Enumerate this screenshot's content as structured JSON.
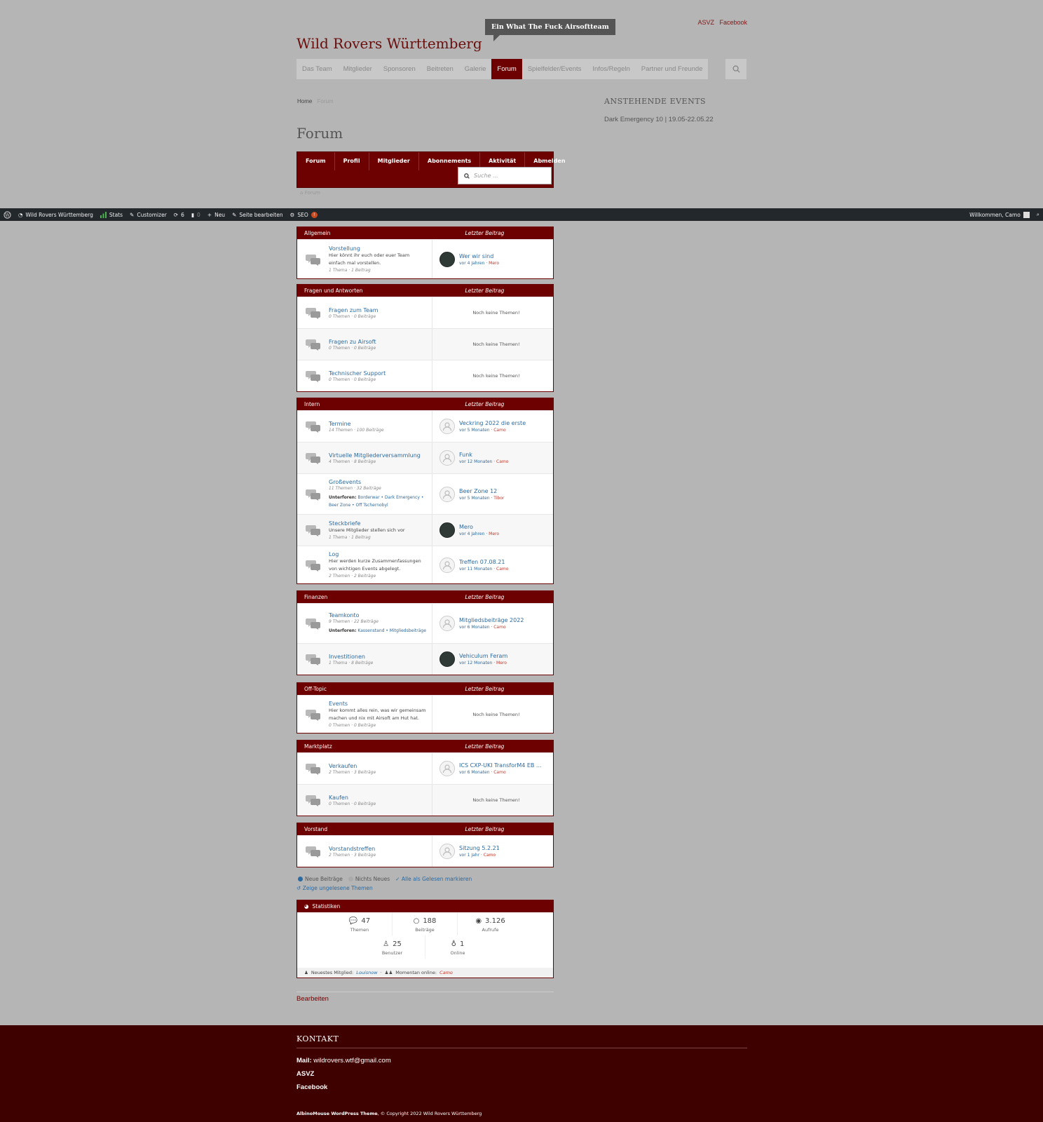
{
  "header": {
    "top_links": [
      "ASVZ",
      "Facebook"
    ],
    "tooltip": "Ein What The Fuck Airsoftteam",
    "site_title": "Wild Rovers Württemberg",
    "nav": [
      "Das Team",
      "Mitglieder",
      "Sponsoren",
      "Beitreten",
      "Galerie",
      "Forum",
      "Spielfelder/Events",
      "Infos/Regeln",
      "Partner und Freunde"
    ],
    "nav_active": "Forum"
  },
  "breadcrumb": {
    "home": "Home",
    "current": "Forum"
  },
  "page_title": "Forum",
  "sidebar": {
    "title": "ANSTEHENDE EVENTS",
    "event": "Dark Emergency 10 | 19.05-22.05.22"
  },
  "forum_nav": {
    "tabs": [
      "Forum",
      "Profil",
      "Mitglieder",
      "Abonnements",
      "Aktivität",
      "Abmelden"
    ],
    "search_placeholder": "Suche ...",
    "crumb": "Forum"
  },
  "adminbar": {
    "site": "Wild Rovers Württemberg",
    "stats": "Stats",
    "customizer": "Customizer",
    "updates": "6",
    "comments": "0",
    "new": "Neu",
    "edit_page": "Seite bearbeiten",
    "seo": "SEO",
    "seo_badge": "!",
    "welcome": "Willkommen, Camo"
  },
  "last_post_label": "Letzter Beitrag",
  "no_topics": "Noch keine Themen!",
  "subforums_label": "Unterforen:",
  "categories": [
    {
      "name": "Allgemein",
      "forums": [
        {
          "title": "Vorstellung",
          "desc": "Hier könnt ihr euch oder euer Team einfach mal vorstellen.",
          "meta": "1 Thema · 1 Beitrag",
          "last": {
            "title": "Wer wir sind",
            "time": "vor 4 Jahren",
            "by": "Mero"
          }
        }
      ]
    },
    {
      "name": "Fragen und Antworten",
      "forums": [
        {
          "title": "Fragen zum Team",
          "meta": "0 Themen · 0 Beiträge"
        },
        {
          "title": "Fragen zu Airsoft",
          "meta": "0 Themen · 0 Beiträge"
        },
        {
          "title": "Technischer Support",
          "meta": "0 Themen · 0 Beiträge"
        }
      ]
    },
    {
      "name": "Intern",
      "forums": [
        {
          "title": "Termine",
          "meta": "14 Themen · 100 Beiträge",
          "last": {
            "title": "Veckring 2022 die erste",
            "time": "vor 5 Monaten",
            "by": "Camo"
          }
        },
        {
          "title": "Virtuelle Mitgliederversammlung",
          "meta": "4 Themen · 8 Beiträge",
          "last": {
            "title": "Funk",
            "time": "vor 12 Monaten",
            "by": "Camo"
          }
        },
        {
          "title": "Großevents",
          "meta": "11 Themen · 32 Beiträge",
          "subforums": "Borderwar • Dark Emergency • Beer Zone • Off Tschernobyl",
          "last": {
            "title": "Beer Zone 12",
            "time": "vor 5 Monaten",
            "by": "Tibor"
          }
        },
        {
          "title": "Steckbriefe",
          "desc": "Unsere Mitglieder stellen sich vor",
          "meta": "1 Thema · 1 Beitrag",
          "last": {
            "title": "Mero",
            "time": "vor 4 Jahren",
            "by": "Mero"
          }
        },
        {
          "title": "Log",
          "desc": "Hier werden kurze Zusammenfassungen von wichtigen Events abgelegt.",
          "meta": "2 Themen · 2 Beiträge",
          "last": {
            "title": "Treffen 07.08.21",
            "time": "vor 11 Monaten",
            "by": "Camo"
          }
        }
      ]
    },
    {
      "name": "Finanzen",
      "forums": [
        {
          "title": "Teamkonto",
          "meta": "9 Themen · 22 Beiträge",
          "subforums": "Kassenstand • Mitgliedsbeiträge",
          "last": {
            "title": "Mitgliedsbeiträge 2022",
            "time": "vor 6 Monaten",
            "by": "Camo"
          }
        },
        {
          "title": "Investitionen",
          "meta": "1 Thema · 8 Beiträge",
          "last": {
            "title": "Vehiculum Feram",
            "time": "vor 12 Monaten",
            "by": "Mero"
          }
        }
      ]
    },
    {
      "name": "Off-Topic",
      "forums": [
        {
          "title": "Events",
          "desc": "Hier kommt alles rein, was wir gemeinsam machen und nix mit Airsoft am Hut hat.",
          "meta": "0 Themen · 0 Beiträge"
        }
      ]
    },
    {
      "name": "Marktplatz",
      "forums": [
        {
          "title": "Verkaufen",
          "meta": "2 Themen · 3 Beiträge",
          "last": {
            "title": "ICS CXP-UKI TransforM4 EB ...",
            "time": "vor 6 Monaten",
            "by": "Camo"
          }
        },
        {
          "title": "Kaufen",
          "meta": "0 Themen · 0 Beiträge"
        }
      ]
    },
    {
      "name": "Vorstand",
      "forums": [
        {
          "title": "Vorstandstreffen",
          "meta": "2 Themen · 3 Beiträge",
          "last": {
            "title": "Sitzung 5.2.21",
            "time": "vor 1 Jahr",
            "by": "Camo"
          }
        }
      ]
    }
  ],
  "legend": {
    "new": "Neue Beiträge",
    "none": "Nichts Neues",
    "mark_all": "Alle als Gelesen markieren",
    "unread": "Zeige ungelesene Themen"
  },
  "stats": {
    "title": "Statistiken",
    "topics": "47",
    "topics_label": "Themen",
    "posts": "188",
    "posts_label": "Beiträge",
    "views": "3.126",
    "views_label": "Aufrufe",
    "users": "25",
    "users_label": "Benutzer",
    "online": "1",
    "online_label": "Online",
    "newest_label": "Neuestes Mitglied:",
    "newest": "Louisnow",
    "online_now_label": "Momentan online:",
    "online_now": "Camo"
  },
  "edit_link": "Bearbeiten",
  "footer": {
    "title": "KONTAKT",
    "mail_label": "Mail:",
    "mail": "wildrovers.wtf@gmail.com",
    "asvz": "ASVZ",
    "facebook": "Facebook",
    "copyright_brand": "AlbinoMouse WordPress Theme",
    "copyright": ", © Copyright 2022 Wild Rovers Württemberg"
  },
  "colors": {
    "brand": "#6d0000",
    "footer": "#3f0000",
    "link": "#2c6aa0",
    "author": "#c0392b"
  }
}
